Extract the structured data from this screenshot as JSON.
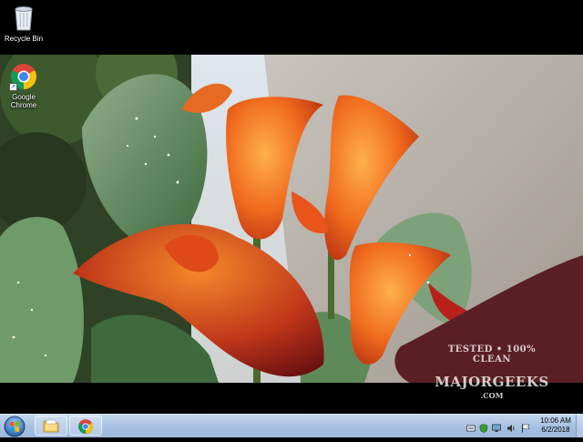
{
  "desktop": {
    "icons": [
      {
        "label": "Recycle Bin",
        "icon": "recycle-bin-icon"
      },
      {
        "label": "Google Chrome",
        "icon": "chrome-icon"
      }
    ]
  },
  "watermark": {
    "line1": "TESTED • 100% CLEAN",
    "line2": "MAJORGEEKS",
    "line3": ".COM"
  },
  "taskbar": {
    "start_icon": "windows-start-icon",
    "pinned": [
      {
        "name": "Windows Explorer",
        "icon": "folder-icon"
      },
      {
        "name": "Google Chrome",
        "icon": "chrome-icon"
      }
    ],
    "tray_icons": [
      "keyboard-icon",
      "security-icon",
      "display-icon",
      "volume-icon",
      "action-center-flag-icon"
    ],
    "clock": {
      "time": "10:06 AM",
      "date": "6/2/2018"
    }
  },
  "colors": {
    "taskbar": "#a9c2e2",
    "background": "#000000",
    "flower_orange": "#f06a1e",
    "leaf_green": "#4f7a4a"
  }
}
